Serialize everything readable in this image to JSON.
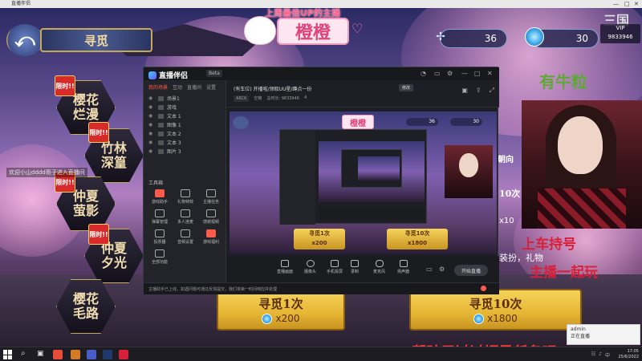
{
  "window_caption": "直播伴侣",
  "game": {
    "page_title": "寻觅",
    "streamer_caption": "上周最佳UP的主播",
    "streamer_name": "橙橙",
    "currency_a": "36",
    "currency_b": "30",
    "vip_label": "VIP",
    "vip_id": "9833946",
    "logo_text": "三国",
    "menu": [
      {
        "label": "樱花\n烂漫",
        "limited": true
      },
      {
        "label": "竹林\n深篁",
        "limited": true
      },
      {
        "label": "仲夏\n萤影",
        "limited": true
      },
      {
        "label": "仲夏\n夕光",
        "limited": true
      },
      {
        "label": "樱花\n毛路",
        "limited": false
      }
    ],
    "limited_tag": "限时!!",
    "welcome_text": "欢迎小山dddd哥子进入直播间",
    "draw_once": {
      "label": "寻觅1次",
      "cost": "x200"
    },
    "draw_ten": {
      "label": "寻觅10次",
      "cost": "x1800"
    },
    "right_shop_text": "装扮，礼物",
    "right_count": "x10",
    "right_times": "10次",
    "right_side_text": "有牛粒",
    "right_side_text2": "朝向",
    "overlay_text_a": "上车持号",
    "overlay_text_b": "主播一起玩",
    "bottom_banner": "帮孩子过过福星任务吧~",
    "notify_title": "admin",
    "notify_body": "正在直播"
  },
  "app": {
    "brand": "直播伴侣",
    "version": "Beta",
    "sidebar_tabs": [
      "我的场景",
      "互动",
      "直播间",
      "设置"
    ],
    "scenes": [
      {
        "label": "场景1"
      },
      {
        "label": "游戏"
      },
      {
        "label": "文本 1"
      },
      {
        "label": "图像 1"
      },
      {
        "label": "文本 2"
      },
      {
        "label": "文本 3"
      },
      {
        "label": "图片 3"
      }
    ],
    "toolbox_label": "工具箱",
    "tools": [
      "游戏助手",
      "礼物特效",
      "主播任务",
      "弹幕管理",
      "多人连麦",
      "感谢视频",
      "投票器",
      "音频设置",
      "游戏福利",
      "全部功能"
    ],
    "room_title": "(有车位) 开播啦/领取UU星/蹲点一份",
    "room_edit": "修改",
    "room_meta": [
      "ARCK",
      "空格",
      "总时长: 9833946",
      "4"
    ],
    "controls": [
      "直播画面",
      "摄像头",
      "手机投屏",
      "录制",
      "麦克风",
      "扬声器"
    ],
    "start_live": "开始直播",
    "statusbar_notice": "主播助手已上线，如遇问题可通过反馈提交，我们将第一时间响应并处理"
  },
  "taskbar": {
    "time": "17:05",
    "date": "25/6/2022"
  },
  "colors": {
    "accent_red": "#ff5a4a",
    "gold": "#c8a85a",
    "pink": "#e0447a"
  }
}
